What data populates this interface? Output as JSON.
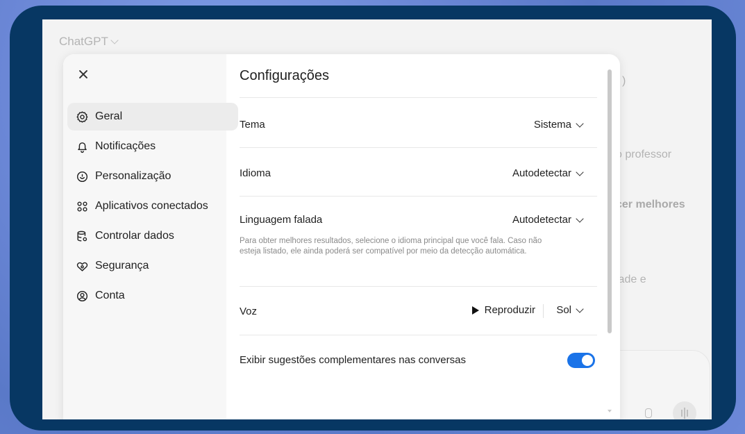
{
  "background": {
    "app_title": "ChatGPT",
    "text_fragments": [
      "o professor",
      "cer melhores",
      "lade e",
      ")"
    ]
  },
  "settings": {
    "title": "Configurações",
    "nav": [
      {
        "label": "Geral",
        "icon": "gear-icon",
        "active": true
      },
      {
        "label": "Notificações",
        "icon": "bell-icon",
        "active": false
      },
      {
        "label": "Personalização",
        "icon": "personalization-icon",
        "active": false
      },
      {
        "label": "Aplicativos conectados",
        "icon": "apps-icon",
        "active": false
      },
      {
        "label": "Controlar dados",
        "icon": "database-icon",
        "active": false
      },
      {
        "label": "Segurança",
        "icon": "security-icon",
        "active": false
      },
      {
        "label": "Conta",
        "icon": "account-icon",
        "active": false
      }
    ],
    "rows": {
      "tema": {
        "label": "Tema",
        "value": "Sistema"
      },
      "idioma": {
        "label": "Idioma",
        "value": "Autodetectar"
      },
      "linguagem": {
        "label": "Linguagem falada",
        "value": "Autodetectar",
        "help": "Para obter melhores resultados, selecione o idioma principal que você fala. Caso não esteja listado, ele ainda poderá ser compatível por meio da detecção automática."
      },
      "voz": {
        "label": "Voz",
        "play_label": "Reproduzir",
        "value": "Sol"
      },
      "sugestoes": {
        "label": "Exibir sugestões complementares nas conversas",
        "enabled": true
      }
    },
    "colors": {
      "accent": "#1a73e8",
      "frame": "#073763"
    }
  }
}
